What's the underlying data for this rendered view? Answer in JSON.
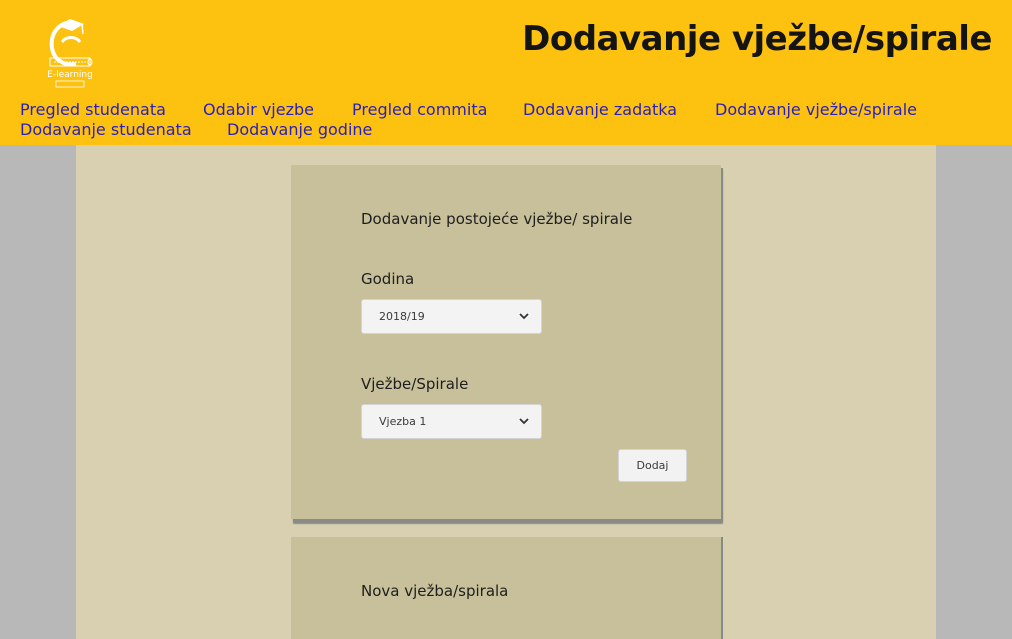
{
  "header": {
    "title": "Dodavanje vježbe/spirale",
    "logo_icon": "elearning-logo-icon",
    "logo_text": "E-learning",
    "background": "#fdc110"
  },
  "nav": {
    "items": [
      {
        "label": "Pregled studenata"
      },
      {
        "label": "Odabir vjezbe"
      },
      {
        "label": "Pregled commita"
      },
      {
        "label": "Dodavanje zadatka"
      },
      {
        "label": "Dodavanje vježbe/spirale"
      },
      {
        "label": "Dodavanje studenata"
      },
      {
        "label": "Dodavanje godine"
      }
    ],
    "link_color": "#2a1fb8"
  },
  "existing_card": {
    "heading": "Dodavanje postojeće vježbe/ spirale",
    "year_label": "Godina",
    "year_value": "2018/19",
    "exercise_label": "Vježbe/Spirale",
    "exercise_value": "Vjezba 1",
    "add_button": "Dodaj",
    "dropdown_icon": "chevron-down-icon"
  },
  "new_card": {
    "heading": "Nova vježba/spirala"
  },
  "colors": {
    "page_bg": "#d8d0b1",
    "card_bg": "#c7c09a",
    "outer_bg": "#b8b8b8"
  }
}
